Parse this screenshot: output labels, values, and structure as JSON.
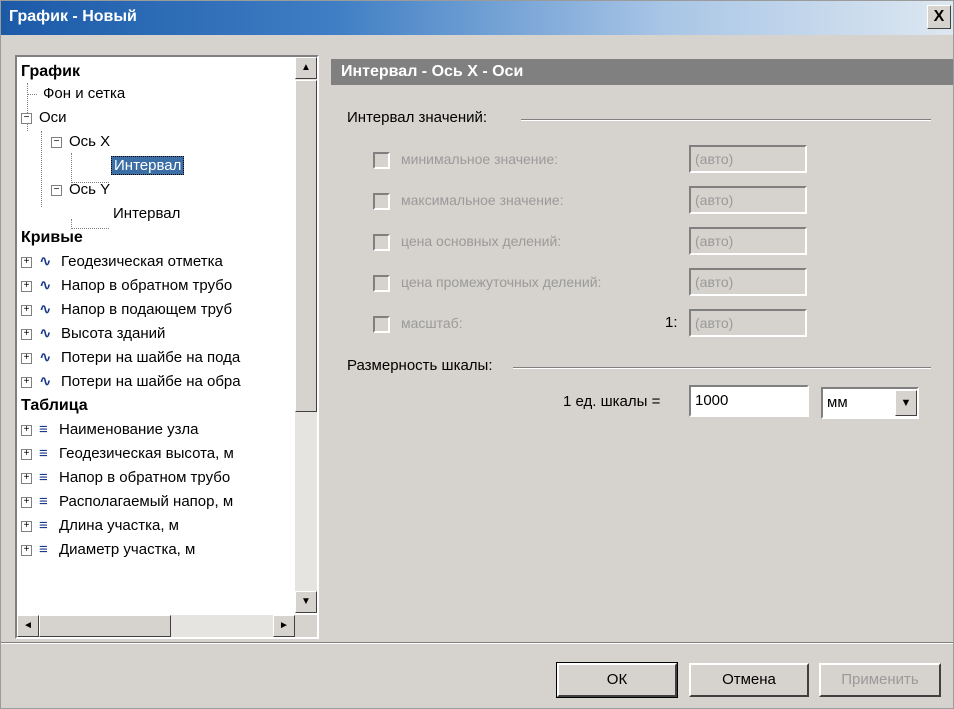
{
  "window": {
    "title": "График - Новый",
    "close_label": "X"
  },
  "tree": {
    "nodes": [
      {
        "label": "График",
        "kind": "head"
      },
      {
        "label": "Фон и сетка",
        "kind": "leaf"
      },
      {
        "label": "Оси",
        "kind": "branch"
      },
      {
        "label": "Ось X",
        "kind": "branch"
      },
      {
        "label": "Интервал",
        "kind": "leaf",
        "selected": true
      },
      {
        "label": "Ось Y",
        "kind": "branch"
      },
      {
        "label": "Интервал",
        "kind": "leaf"
      },
      {
        "label": "Кривые",
        "kind": "head"
      },
      {
        "label": "Геодезическая отметка",
        "kind": "curve"
      },
      {
        "label": "Напор в обратном трубо",
        "kind": "curve"
      },
      {
        "label": "Напор в подающем труб",
        "kind": "curve"
      },
      {
        "label": "Высота зданий",
        "kind": "curve"
      },
      {
        "label": "Потери на шайбе на пода",
        "kind": "curve"
      },
      {
        "label": "Потери на шайбе на обра",
        "kind": "curve"
      },
      {
        "label": "Таблица",
        "kind": "head"
      },
      {
        "label": "Наименование узла",
        "kind": "table"
      },
      {
        "label": "Геодезическая высота, м",
        "kind": "table"
      },
      {
        "label": "Напор в обратном трубо",
        "kind": "table"
      },
      {
        "label": "Располагаемый напор, м",
        "kind": "table"
      },
      {
        "label": "Длина участка, м",
        "kind": "table"
      },
      {
        "label": "Диаметр участка, м",
        "kind": "table"
      }
    ],
    "icons": {
      "curve": "wave-icon",
      "table": "lines-icon"
    }
  },
  "panel": {
    "header": "Интервал - Ось X - Оси",
    "range_group": {
      "label": "Интервал значений:",
      "options": [
        {
          "label": "минимальное значение:",
          "value": "(авто)",
          "checked": false,
          "enabled": false
        },
        {
          "label": "максимальное значение:",
          "value": "(авто)",
          "checked": false,
          "enabled": false
        },
        {
          "label": "цена основных делений:",
          "value": "(авто)",
          "checked": false,
          "enabled": false
        },
        {
          "label": "цена промежуточных делений:",
          "value": "(авто)",
          "checked": false,
          "enabled": false
        },
        {
          "label": "масштаб:",
          "prefix": "1:",
          "value": "(авто)",
          "checked": false,
          "enabled": false
        }
      ]
    },
    "scale_group": {
      "label": "Размерность шкалы:",
      "unit_label": "1 ед. шкалы =",
      "unit_value": "1000",
      "unit_select": "мм"
    }
  },
  "buttons": {
    "ok": "ОК",
    "cancel": "Отмена",
    "apply": "Применить"
  }
}
